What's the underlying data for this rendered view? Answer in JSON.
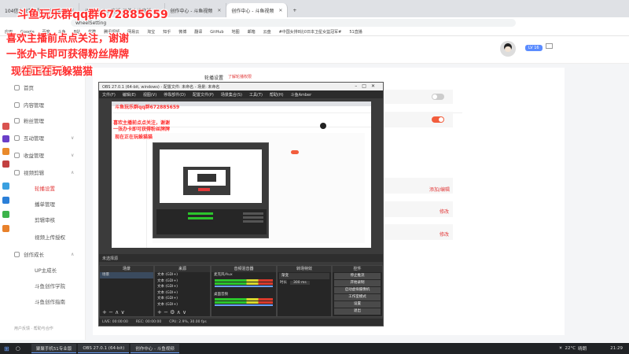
{
  "browser": {
    "tabs": [
      {
        "label": "104信息发布 - 聚力开放运营"
      },
      {
        "label": "斗鱼 Amber直播_恐怖之类直播"
      },
      {
        "label": "创作中心 - 斗鱼视频"
      },
      {
        "label": "创作中心 - 斗鱼视频"
      }
    ],
    "url": "wheelSetting",
    "bookmarks": [
      "应用",
      "Google",
      "百度",
      "斗鱼",
      "B站",
      "优酷",
      "腾讯视频",
      "网易云",
      "淘宝",
      "知乎",
      "微博",
      "翻译",
      "GitHub",
      "地图",
      "邮箱",
      "云盘",
      "#中国女排8比0日本卫星女篮冠军#",
      "51直播"
    ]
  },
  "overlay": {
    "line1": "斗鱼玩乐群qq群672885659",
    "line2": "喜欢主播前点点关注，谢谢",
    "line3": "一张办卡即可获得粉丝牌牌",
    "line4": "现在正在玩",
    "line4_game": "躲猫猫"
  },
  "header": {
    "logo": "DOUYU.COM",
    "user_badge": "LV 16",
    "mail_icon": "mail-icon"
  },
  "sidebar": {
    "user_button": "创作中心",
    "items": [
      {
        "label": "首页",
        "active": false
      },
      {
        "label": "内容管理",
        "active": false
      },
      {
        "label": "粉丝管理",
        "active": false
      },
      {
        "label": "互动管理",
        "active": false,
        "chevron": "∨"
      },
      {
        "label": "收益管理",
        "active": false,
        "chevron": "∨"
      },
      {
        "label": "视频剪辑",
        "active": false,
        "chevron": "∧"
      },
      {
        "label": "轮播设置",
        "active": true
      },
      {
        "label": "播单管理",
        "active": false
      },
      {
        "label": "剪辑审核",
        "active": false
      },
      {
        "label": "视频上传授权",
        "active": false
      },
      {
        "label": "创作成长",
        "active": false,
        "chevron": "∧"
      },
      {
        "label": "UP主成长",
        "active": false
      },
      {
        "label": "斗鱼创作学院",
        "active": false
      },
      {
        "label": "斗鱼创作指南",
        "active": false
      }
    ],
    "footer": "用户反馈 · 帮助与合作"
  },
  "content": {
    "tab_title": "轮播设置",
    "tab_link": "了解轮播权限",
    "toggle1": false,
    "toggle2": true,
    "link_add": "添加/编辑",
    "link_edit1": "修改",
    "link_edit2": "修改"
  },
  "obs": {
    "title": "OBS 27.0.1 (64-bit, windows) - 配置文件: 未命名 - 场景: 未命名",
    "menu": [
      "文件(F)",
      "编辑(E)",
      "视图(V)",
      "停靠部件(D)",
      "配置文件(P)",
      "场景集合(S)",
      "工具(T)",
      "帮助(H)",
      "斗鱼Amber"
    ],
    "dock_header": "未选择源",
    "docks": {
      "scenes": "场景",
      "sources": "来源",
      "mixer": "音频混音器",
      "transitions": "转场特效",
      "controls": "控件"
    },
    "scene_items": [
      "场景"
    ],
    "source_items": [
      "文本 (GDI+)",
      "文本 (GDI+)",
      "文本 (GDI+)",
      "文本 (GDI+)",
      "文本 (GDI+)",
      "文本 (GDI+)"
    ],
    "mixer_items": [
      "麦克风/Aux",
      "桌面音频"
    ],
    "transition_type": "渐变",
    "transition_duration_label": "时长",
    "transition_duration": "300 ms",
    "controls": [
      "停止推流",
      "开始录制",
      "启动虚拟摄像机",
      "工作室模式",
      "设置",
      "退出"
    ],
    "status": {
      "live": "LIVE: 00:00:00",
      "rec": "REC: 00:00:00",
      "cpu": "CPU: 2.9%, 30.00 fps"
    }
  },
  "taskbar": {
    "apps": [
      "聚聚手机51专业版",
      "OBS 27.0.1 (64-bit)",
      "创作中心 - 斗鱼视频"
    ],
    "weather": "22°C",
    "weather_desc": "晴朗",
    "time": "21:29"
  }
}
